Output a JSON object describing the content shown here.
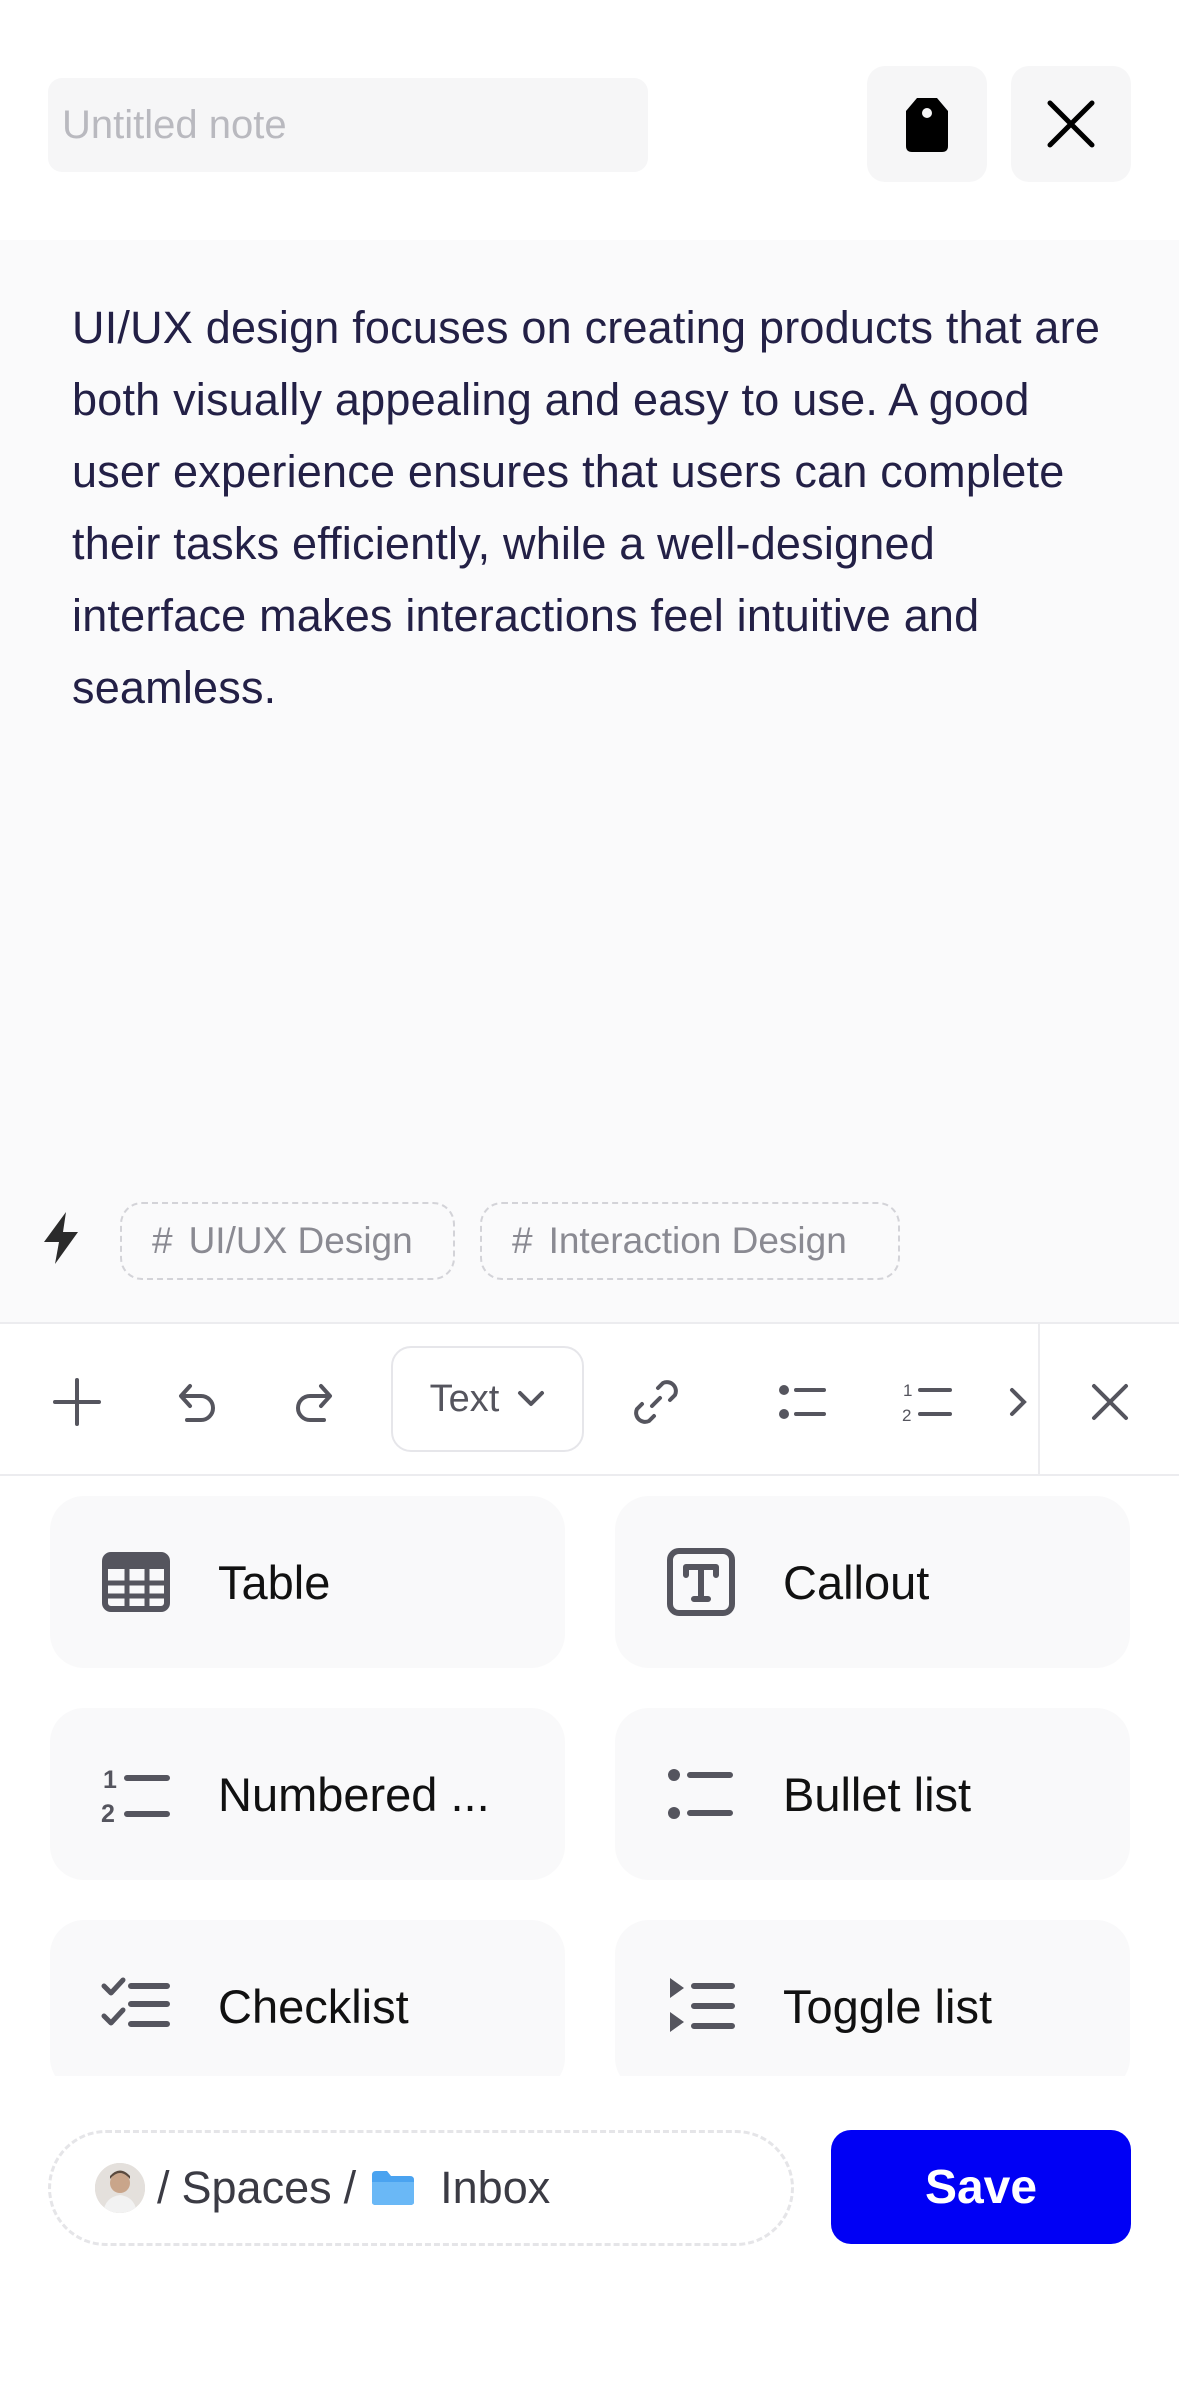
{
  "header": {
    "title_placeholder": "Untitled note",
    "title_value": "",
    "tag_icon": "tag-icon",
    "close_icon": "close-icon"
  },
  "editor": {
    "body": "UI/UX design focuses on creating products that are both visually appealing and easy to use. A good user experience ensures that users can complete their tasks efficiently, while a well-designed interface makes interactions feel intuitive and seamless.",
    "tags": [
      {
        "hash": "#",
        "label": "UI/UX Design"
      },
      {
        "hash": "#",
        "label": "Interaction Design"
      }
    ]
  },
  "toolbar": {
    "text_style": "Text",
    "icons": [
      "plus-icon",
      "undo-icon",
      "redo-icon",
      "link-icon",
      "bullet-list-icon",
      "numbered-list-icon",
      "close-icon"
    ]
  },
  "blocks": [
    {
      "label": "Table",
      "icon": "table-icon"
    },
    {
      "label": "Callout",
      "icon": "callout-icon"
    },
    {
      "label": "Numbered ...",
      "icon": "numbered-list-icon"
    },
    {
      "label": "Bullet list",
      "icon": "bullet-list-icon"
    },
    {
      "label": "Checklist",
      "icon": "checklist-icon"
    },
    {
      "label": "Toggle list",
      "icon": "toggle-list-icon"
    }
  ],
  "footer": {
    "separator_1": "/",
    "spaces_label": "Spaces",
    "separator_2": "/",
    "folder_label": "Inbox",
    "save_label": "Save"
  },
  "colors": {
    "accent": "#0000f5",
    "body_text": "#232046",
    "folder": "#4aa3f0"
  }
}
